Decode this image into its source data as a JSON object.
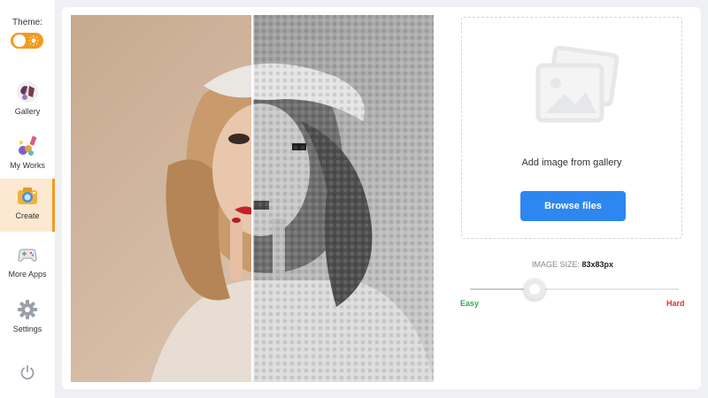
{
  "sidebar": {
    "theme_label": "Theme:",
    "theme_mode": "light",
    "items": [
      {
        "label": "Gallery",
        "icon": "gallery-icon"
      },
      {
        "label": "My Works",
        "icon": "my-works-icon"
      },
      {
        "label": "Create",
        "icon": "camera-icon",
        "active": true
      },
      {
        "label": "More Apps",
        "icon": "gamepad-icon"
      },
      {
        "label": "Settings",
        "icon": "gear-icon"
      }
    ],
    "power_icon": "power-icon"
  },
  "preview": {
    "left": "original-photo",
    "right": "pixelated-grayscale-photo"
  },
  "upload": {
    "text": "Add image from gallery",
    "button_label": "Browse files",
    "icon": "image-placeholder-icon"
  },
  "settings": {
    "size_label": "IMAGE SIZE:",
    "size_value": "83x83px",
    "difficulty_min_label": "Easy",
    "difficulty_max_label": "Hard",
    "difficulty_fraction": 0.31
  },
  "colors": {
    "accent": "#f39a1f",
    "button": "#2e86f0",
    "easy": "#2cab4a",
    "hard": "#d9342b"
  }
}
